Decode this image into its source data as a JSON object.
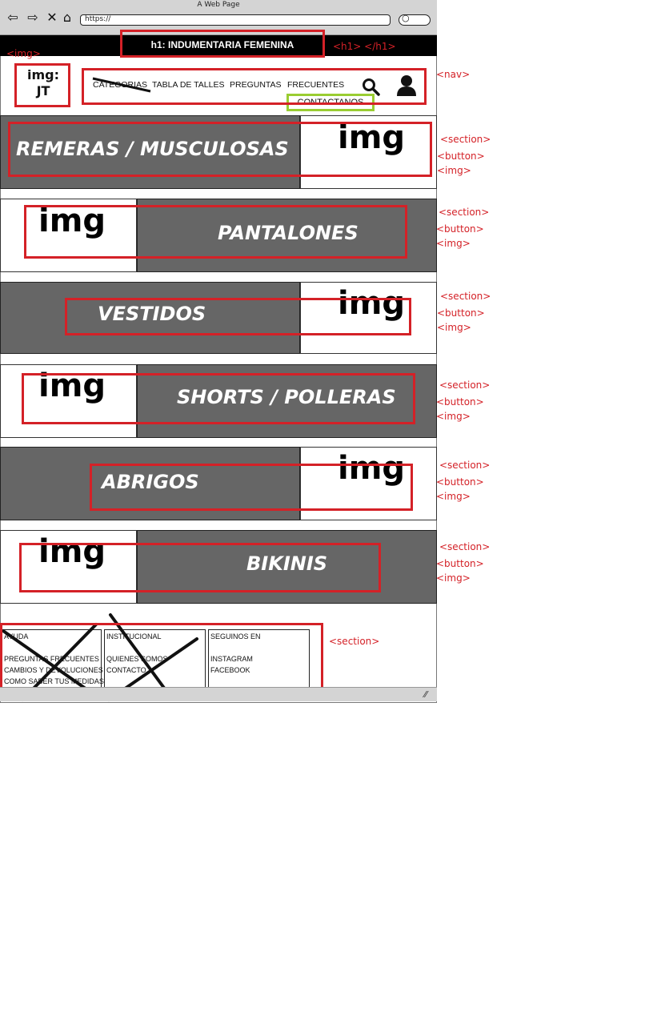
{
  "window_title": "A Web Page",
  "url": "https://",
  "h1_text": "h1: INDUMENTARIA FEMENINA",
  "logo_text": "img:\nJT",
  "nav_items": [
    "CATEGORIAS",
    "TABLA DE TALLES",
    "PREGUNTAS",
    "FRECUENTES"
  ],
  "contact_label": "CONTACTANOS",
  "sections": [
    {
      "button": "REMERAS / MUSCULOSAS",
      "img": "img"
    },
    {
      "button": "PANTALONES",
      "img": "img"
    },
    {
      "button": "VESTIDOS",
      "img": "img"
    },
    {
      "button": "SHORTS / POLLERAS",
      "img": "img"
    },
    {
      "button": "ABRIGOS",
      "img": "img"
    },
    {
      "button": "BIKINIS",
      "img": "img"
    }
  ],
  "annotations": {
    "img_tag": "<img>",
    "h1_tag": "<h1> </h1>",
    "nav_tag": "<nav>",
    "section_tag": "<section>",
    "button_tag": "<button>",
    "footer_section_tag": "<section>"
  },
  "footer": {
    "col1": [
      "AYUDA",
      "",
      "PREGUNTAS FRECUENTES",
      "CAMBIOS Y DEVOLUCIONES",
      "COMO SABER TUS MEDIDAS"
    ],
    "col2": [
      "INSTITUCIONAL",
      "",
      "QUIENES SOMOS",
      "CONTACTO"
    ],
    "col3": [
      "SEGUINOS EN",
      "",
      "INSTAGRAM",
      "FACEBOOK"
    ]
  },
  "colors": {
    "annotation_red": "#d42127",
    "contact_green": "#9acd32",
    "button_fill": "#666666"
  }
}
